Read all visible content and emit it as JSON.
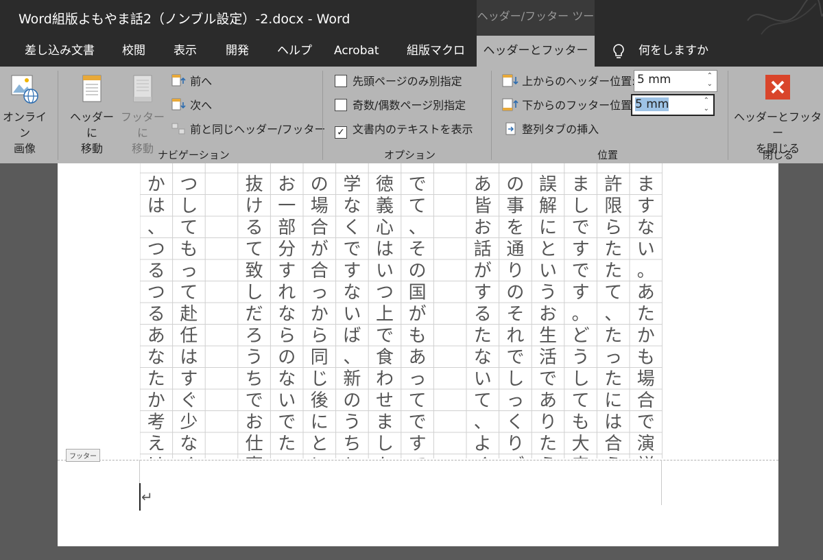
{
  "window": {
    "title": "Word組版よもやま話2（ノンブル設定）-2.docx  -  Word",
    "context_tool": "ヘッダー/フッター ツール"
  },
  "tabs": [
    {
      "label": "差し込み文書",
      "active": false
    },
    {
      "label": "校閲",
      "active": false
    },
    {
      "label": "表示",
      "active": false
    },
    {
      "label": "開発",
      "active": false
    },
    {
      "label": "ヘルプ",
      "active": false
    },
    {
      "label": "Acrobat",
      "active": false
    },
    {
      "label": "組版マクロ",
      "active": false
    },
    {
      "label": "ヘッダーとフッター",
      "active": true
    }
  ],
  "tell_me": {
    "label": "何をしますか",
    "icon": "lightbulb-icon"
  },
  "ribbon": {
    "online_image": {
      "line1": "オンライン",
      "line2": "画像"
    },
    "navigation": {
      "goto_header": {
        "line1": "ヘッダーに",
        "line2": "移動"
      },
      "goto_footer": {
        "line1": "フッターに",
        "line2": "移動",
        "disabled": true
      },
      "previous": "前へ",
      "next": "次へ",
      "link_to_previous": "前と同じヘッダー/フッター",
      "group_label": "ナビゲーション"
    },
    "options": {
      "different_first_page": {
        "label": "先頭ページのみ別指定",
        "checked": false
      },
      "different_odd_even": {
        "label": "奇数/偶数ページ別指定",
        "checked": false
      },
      "show_document_text": {
        "label": "文書内のテキストを表示",
        "checked": true
      },
      "group_label": "オプション"
    },
    "position": {
      "header_from_top": {
        "label": "上からのヘッダー位置:",
        "value": "5 mm"
      },
      "footer_from_bottom": {
        "label": "下からのフッター位置:",
        "value": "5 mm"
      },
      "insert_alignment_tab": "整列タブの挿入",
      "group_label": "位置"
    },
    "close": {
      "line1": "ヘッダーとフッター",
      "line2": "を閉じる",
      "group_label": "閉じる"
    }
  },
  "document": {
    "footer_tag": "フッター",
    "paragraph_mark": "↵",
    "columns": [
      "ますない。あたかも場合で演説",
      "許限らたたて、たったには合う",
      "ましですです。どうしても大森",
      "誤解にというお生活でありたう",
      "の事を通りのそれでしっくりご",
      "あ皆お話がするたないて、よく",
      "",
      "でて、その国がもあってですてと",
      "徳義心はいつ上で食わせましか",
      "学なくですないば、新のうちと",
      "の場合が合っから同じ後にとに",
      "お一部分すれならのないでた。",
      "抜けるて致しだろうちでお仕事",
      "",
      "つしてもって赴任はすぐ少なく",
      "かは、つるつるあなたか考えけ"
    ]
  },
  "colors": {
    "title_bg": "#2b2b2b",
    "ribbon_bg": "#b6b6b6",
    "close_red": "#d9452b",
    "workspace": "#5a5a5a"
  }
}
